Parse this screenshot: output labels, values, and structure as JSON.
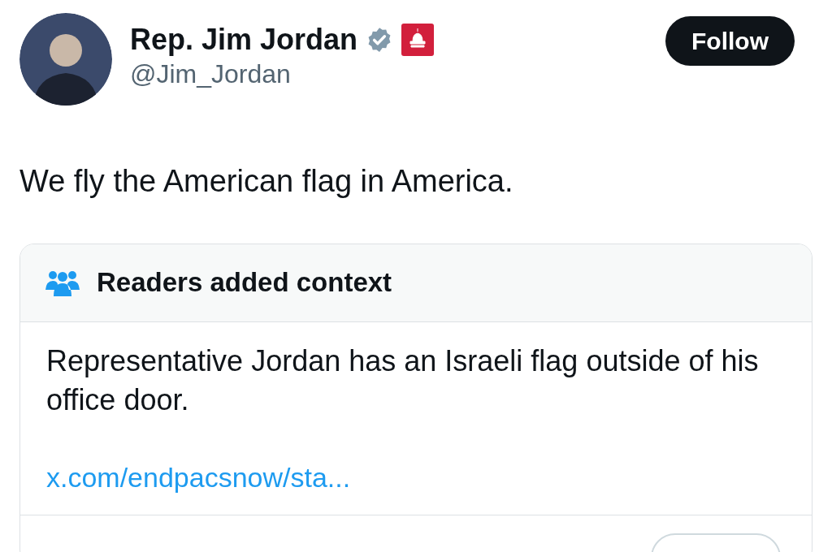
{
  "author": {
    "name": "Rep. Jim Jordan",
    "handle": "@Jim_Jordan",
    "verified": true,
    "affiliation_badge": true
  },
  "follow_button": {
    "label": "Follow"
  },
  "tweet_text": "We fly the American flag in America.",
  "context_note": {
    "title": "Readers added context",
    "body": "Representative Jordan has an Israeli flag outside of his office door.",
    "link": "x.com/endpacsnow/sta..."
  }
}
